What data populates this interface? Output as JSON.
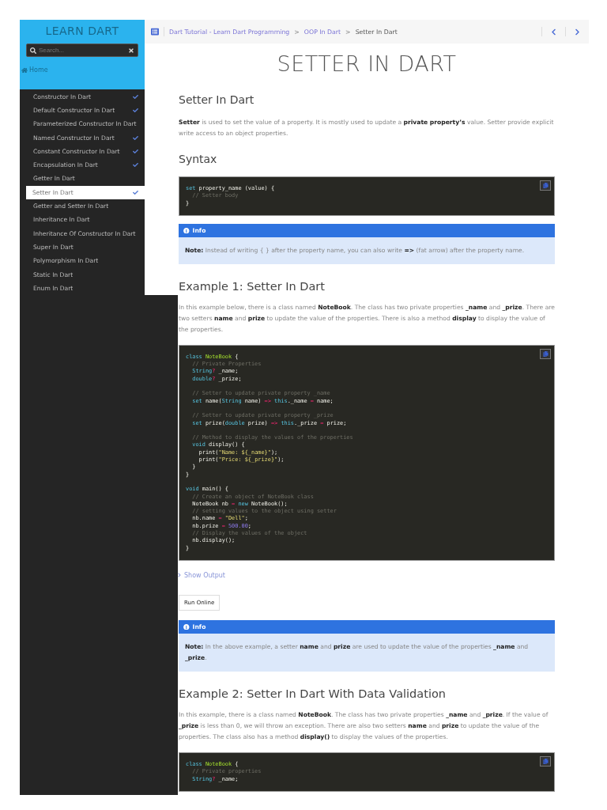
{
  "sidebar": {
    "title": "LEARN DART",
    "search": {
      "placeholder": "Search..."
    },
    "home": "Home",
    "items": [
      {
        "label": "Constructor In Dart",
        "selected": false,
        "done": true
      },
      {
        "label": "Default Constructor In Dart",
        "selected": false,
        "done": true
      },
      {
        "label": "Parameterized Constructor In Dart",
        "selected": false,
        "done": false
      },
      {
        "label": "Named Constructor In Dart",
        "selected": false,
        "done": true
      },
      {
        "label": "Constant Constructor In Dart",
        "selected": false,
        "done": true
      },
      {
        "label": "Encapsulation In Dart",
        "selected": false,
        "done": true
      },
      {
        "label": "Getter In Dart",
        "selected": false,
        "done": false
      },
      {
        "label": "Setter In Dart",
        "selected": true,
        "done": true
      },
      {
        "label": "Getter and Setter In Dart",
        "selected": false,
        "done": false
      },
      {
        "label": "Inheritance In Dart",
        "selected": false,
        "done": false
      },
      {
        "label": "Inheritance Of Constructor In Dart",
        "selected": false,
        "done": false
      },
      {
        "label": "Super In Dart",
        "selected": false,
        "done": false
      },
      {
        "label": "Polymorphism In Dart",
        "selected": false,
        "done": false
      },
      {
        "label": "Static In Dart",
        "selected": false,
        "done": false
      },
      {
        "label": "Enum In Dart",
        "selected": false,
        "done": false
      }
    ]
  },
  "breadcrumb": [
    {
      "label": "Dart Tutorial - Learn Dart Programming",
      "current": false
    },
    {
      "label": "OOP In Dart",
      "current": false
    },
    {
      "label": "Setter In Dart",
      "current": true
    }
  ],
  "separator": ">",
  "page_title": "SETTER IN DART",
  "blocks": [
    {
      "kind": "subheading",
      "text": "Setter In Dart"
    },
    {
      "kind": "paragraph",
      "text": "**Setter** is used to set the value of a property. It is mostly used to update a **private property’s** value. Setter provide explicit write access to an object properties."
    },
    {
      "kind": "subheading",
      "text": "Syntax"
    },
    {
      "kind": "code",
      "lines": [
        {
          "tokens": [
            {
              "kind": "keyword",
              "text": "set "
            },
            {
              "kind": "plain",
              "text": "property_name (value) {"
            }
          ]
        },
        {
          "tokens": [
            {
              "kind": "comment",
              "text": "  // Setter body"
            }
          ]
        },
        {
          "tokens": [
            {
              "kind": "plain",
              "text": "}"
            }
          ]
        }
      ]
    },
    {
      "kind": "info",
      "title": "Info",
      "text": "**Note:** Instead of writing { } after the property name, you can also write **=>** (fat arrow) after the property name."
    },
    {
      "kind": "heading",
      "text": "Example 1: Setter In Dart"
    },
    {
      "kind": "paragraph",
      "text": "In this example below, there is a class named **NoteBook**. The class has two private properties **_name** and **_prize**. There are two setters **name** and **prize** to update the value of the properties. There is also a method **display** to display the value of the properties."
    },
    {
      "kind": "code",
      "lines": [
        {
          "tokens": [
            {
              "kind": "keyword",
              "text": "class "
            },
            {
              "kind": "class",
              "text": "NoteBook"
            },
            {
              "kind": "plain",
              "text": " {"
            }
          ]
        },
        {
          "tokens": [
            {
              "kind": "comment",
              "text": "  // Private Properties"
            }
          ]
        },
        {
          "tokens": [
            {
              "kind": "keyword",
              "text": "  String"
            },
            {
              "kind": "operator",
              "text": "?"
            },
            {
              "kind": "plain",
              "text": " _name;"
            }
          ]
        },
        {
          "tokens": [
            {
              "kind": "keyword",
              "text": "  double"
            },
            {
              "kind": "operator",
              "text": "?"
            },
            {
              "kind": "plain",
              "text": " _prize;"
            }
          ]
        },
        {
          "blank_before": true,
          "tokens": [
            {
              "kind": "comment",
              "text": "  // Setter to update private property _name"
            }
          ]
        },
        {
          "tokens": [
            {
              "kind": "keyword",
              "text": "  set "
            },
            {
              "kind": "plain",
              "text": "name("
            },
            {
              "kind": "keyword",
              "text": "String"
            },
            {
              "kind": "plain",
              "text": " name) "
            },
            {
              "kind": "operator",
              "text": "=>"
            },
            {
              "kind": "keyword",
              "text": " this"
            },
            {
              "kind": "plain",
              "text": "._name "
            },
            {
              "kind": "operator",
              "text": "="
            },
            {
              "kind": "plain",
              "text": " name;"
            }
          ]
        },
        {
          "blank_before": true,
          "tokens": [
            {
              "kind": "comment",
              "text": "  // Setter to update private property _prize"
            }
          ]
        },
        {
          "tokens": [
            {
              "kind": "keyword",
              "text": "  set "
            },
            {
              "kind": "plain",
              "text": "prize("
            },
            {
              "kind": "keyword",
              "text": "double"
            },
            {
              "kind": "plain",
              "text": " prize) "
            },
            {
              "kind": "operator",
              "text": "=>"
            },
            {
              "kind": "keyword",
              "text": " this"
            },
            {
              "kind": "plain",
              "text": "._prize "
            },
            {
              "kind": "operator",
              "text": "="
            },
            {
              "kind": "plain",
              "text": " prize;"
            }
          ]
        },
        {
          "blank_before": true,
          "tokens": [
            {
              "kind": "comment",
              "text": "  // Method to display the values of the properties"
            }
          ]
        },
        {
          "tokens": [
            {
              "kind": "keyword",
              "text": "  void "
            },
            {
              "kind": "plain",
              "text": "display() {"
            }
          ]
        },
        {
          "tokens": [
            {
              "kind": "plain",
              "text": "    print("
            },
            {
              "kind": "string",
              "text": "\"Name: ${_name}\""
            },
            {
              "kind": "plain",
              "text": ");"
            }
          ]
        },
        {
          "tokens": [
            {
              "kind": "plain",
              "text": "    print("
            },
            {
              "kind": "string",
              "text": "\"Price: ${_prize}\""
            },
            {
              "kind": "plain",
              "text": ");"
            }
          ]
        },
        {
          "tokens": [
            {
              "kind": "plain",
              "text": "  }"
            }
          ]
        },
        {
          "tokens": [
            {
              "kind": "plain",
              "text": "}"
            }
          ]
        },
        {
          "blank_before": true,
          "tokens": [
            {
              "kind": "keyword",
              "text": "void "
            },
            {
              "kind": "plain",
              "text": "main() {"
            }
          ]
        },
        {
          "tokens": [
            {
              "kind": "comment",
              "text": "  // Create an object of NoteBook class"
            }
          ]
        },
        {
          "tokens": [
            {
              "kind": "plain",
              "text": "  NoteBook nb "
            },
            {
              "kind": "operator",
              "text": "="
            },
            {
              "kind": "keyword",
              "text": " new "
            },
            {
              "kind": "plain",
              "text": "NoteBook();"
            }
          ]
        },
        {
          "tokens": [
            {
              "kind": "comment",
              "text": "  // setting values to the object using setter"
            }
          ]
        },
        {
          "tokens": [
            {
              "kind": "plain",
              "text": "  nb.name "
            },
            {
              "kind": "operator",
              "text": "="
            },
            {
              "kind": "string",
              "text": " \"Dell\""
            },
            {
              "kind": "plain",
              "text": ";"
            }
          ]
        },
        {
          "tokens": [
            {
              "kind": "plain",
              "text": "  nb.prize "
            },
            {
              "kind": "operator",
              "text": "="
            },
            {
              "kind": "number",
              "text": " 500.00"
            },
            {
              "kind": "plain",
              "text": ";"
            }
          ]
        },
        {
          "tokens": [
            {
              "kind": "comment",
              "text": "  // Display the values of the object"
            }
          ]
        },
        {
          "tokens": [
            {
              "kind": "plain",
              "text": "  nb.display();"
            }
          ]
        },
        {
          "tokens": [
            {
              "kind": "plain",
              "text": "}"
            }
          ]
        }
      ]
    },
    {
      "kind": "toggle",
      "text": "Show Output",
      "expanded": false
    },
    {
      "kind": "button",
      "text": "Run Online"
    },
    {
      "kind": "info",
      "title": "Info",
      "text": "**Note:** In the above example, a setter **name** and **prize** are used to update the value of the properties **_name** and **_prize**."
    },
    {
      "kind": "heading",
      "text": "Example 2: Setter In Dart With Data Validation"
    },
    {
      "kind": "paragraph",
      "text": "In this example, there is a class named **NoteBook**. The class has two private properties **_name** and **_prize**. If the value of **_prize** is less than 0, we will throw an exception. There are also two setters **name** and **prize** to update the value of the properties. The class also has a method **display()** to display the values of the properties."
    },
    {
      "kind": "code",
      "lines": [
        {
          "tokens": [
            {
              "kind": "keyword",
              "text": "class "
            },
            {
              "kind": "class",
              "text": "NoteBook"
            },
            {
              "kind": "plain",
              "text": " {"
            }
          ]
        },
        {
          "tokens": [
            {
              "kind": "comment",
              "text": "  // Private properties"
            }
          ]
        },
        {
          "tokens": [
            {
              "kind": "keyword",
              "text": "  String"
            },
            {
              "kind": "operator",
              "text": "?"
            },
            {
              "kind": "plain",
              "text": " _name;"
            }
          ]
        }
      ]
    }
  ]
}
